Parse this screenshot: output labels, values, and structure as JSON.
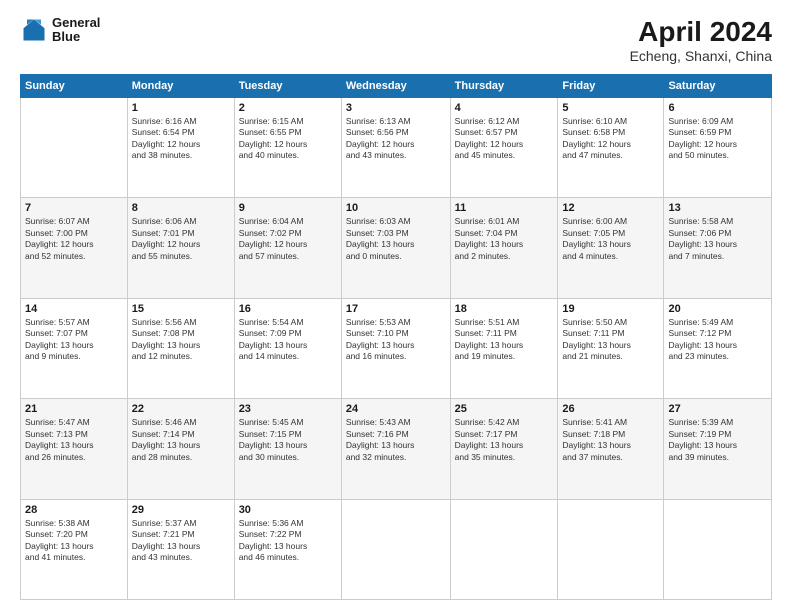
{
  "logo": {
    "line1": "General",
    "line2": "Blue"
  },
  "title": "April 2024",
  "subtitle": "Echeng, Shanxi, China",
  "weekdays": [
    "Sunday",
    "Monday",
    "Tuesday",
    "Wednesday",
    "Thursday",
    "Friday",
    "Saturday"
  ],
  "weeks": [
    [
      {
        "day": "",
        "info": ""
      },
      {
        "day": "1",
        "info": "Sunrise: 6:16 AM\nSunset: 6:54 PM\nDaylight: 12 hours\nand 38 minutes."
      },
      {
        "day": "2",
        "info": "Sunrise: 6:15 AM\nSunset: 6:55 PM\nDaylight: 12 hours\nand 40 minutes."
      },
      {
        "day": "3",
        "info": "Sunrise: 6:13 AM\nSunset: 6:56 PM\nDaylight: 12 hours\nand 43 minutes."
      },
      {
        "day": "4",
        "info": "Sunrise: 6:12 AM\nSunset: 6:57 PM\nDaylight: 12 hours\nand 45 minutes."
      },
      {
        "day": "5",
        "info": "Sunrise: 6:10 AM\nSunset: 6:58 PM\nDaylight: 12 hours\nand 47 minutes."
      },
      {
        "day": "6",
        "info": "Sunrise: 6:09 AM\nSunset: 6:59 PM\nDaylight: 12 hours\nand 50 minutes."
      }
    ],
    [
      {
        "day": "7",
        "info": "Sunrise: 6:07 AM\nSunset: 7:00 PM\nDaylight: 12 hours\nand 52 minutes."
      },
      {
        "day": "8",
        "info": "Sunrise: 6:06 AM\nSunset: 7:01 PM\nDaylight: 12 hours\nand 55 minutes."
      },
      {
        "day": "9",
        "info": "Sunrise: 6:04 AM\nSunset: 7:02 PM\nDaylight: 12 hours\nand 57 minutes."
      },
      {
        "day": "10",
        "info": "Sunrise: 6:03 AM\nSunset: 7:03 PM\nDaylight: 13 hours\nand 0 minutes."
      },
      {
        "day": "11",
        "info": "Sunrise: 6:01 AM\nSunset: 7:04 PM\nDaylight: 13 hours\nand 2 minutes."
      },
      {
        "day": "12",
        "info": "Sunrise: 6:00 AM\nSunset: 7:05 PM\nDaylight: 13 hours\nand 4 minutes."
      },
      {
        "day": "13",
        "info": "Sunrise: 5:58 AM\nSunset: 7:06 PM\nDaylight: 13 hours\nand 7 minutes."
      }
    ],
    [
      {
        "day": "14",
        "info": "Sunrise: 5:57 AM\nSunset: 7:07 PM\nDaylight: 13 hours\nand 9 minutes."
      },
      {
        "day": "15",
        "info": "Sunrise: 5:56 AM\nSunset: 7:08 PM\nDaylight: 13 hours\nand 12 minutes."
      },
      {
        "day": "16",
        "info": "Sunrise: 5:54 AM\nSunset: 7:09 PM\nDaylight: 13 hours\nand 14 minutes."
      },
      {
        "day": "17",
        "info": "Sunrise: 5:53 AM\nSunset: 7:10 PM\nDaylight: 13 hours\nand 16 minutes."
      },
      {
        "day": "18",
        "info": "Sunrise: 5:51 AM\nSunset: 7:11 PM\nDaylight: 13 hours\nand 19 minutes."
      },
      {
        "day": "19",
        "info": "Sunrise: 5:50 AM\nSunset: 7:11 PM\nDaylight: 13 hours\nand 21 minutes."
      },
      {
        "day": "20",
        "info": "Sunrise: 5:49 AM\nSunset: 7:12 PM\nDaylight: 13 hours\nand 23 minutes."
      }
    ],
    [
      {
        "day": "21",
        "info": "Sunrise: 5:47 AM\nSunset: 7:13 PM\nDaylight: 13 hours\nand 26 minutes."
      },
      {
        "day": "22",
        "info": "Sunrise: 5:46 AM\nSunset: 7:14 PM\nDaylight: 13 hours\nand 28 minutes."
      },
      {
        "day": "23",
        "info": "Sunrise: 5:45 AM\nSunset: 7:15 PM\nDaylight: 13 hours\nand 30 minutes."
      },
      {
        "day": "24",
        "info": "Sunrise: 5:43 AM\nSunset: 7:16 PM\nDaylight: 13 hours\nand 32 minutes."
      },
      {
        "day": "25",
        "info": "Sunrise: 5:42 AM\nSunset: 7:17 PM\nDaylight: 13 hours\nand 35 minutes."
      },
      {
        "day": "26",
        "info": "Sunrise: 5:41 AM\nSunset: 7:18 PM\nDaylight: 13 hours\nand 37 minutes."
      },
      {
        "day": "27",
        "info": "Sunrise: 5:39 AM\nSunset: 7:19 PM\nDaylight: 13 hours\nand 39 minutes."
      }
    ],
    [
      {
        "day": "28",
        "info": "Sunrise: 5:38 AM\nSunset: 7:20 PM\nDaylight: 13 hours\nand 41 minutes."
      },
      {
        "day": "29",
        "info": "Sunrise: 5:37 AM\nSunset: 7:21 PM\nDaylight: 13 hours\nand 43 minutes."
      },
      {
        "day": "30",
        "info": "Sunrise: 5:36 AM\nSunset: 7:22 PM\nDaylight: 13 hours\nand 46 minutes."
      },
      {
        "day": "",
        "info": ""
      },
      {
        "day": "",
        "info": ""
      },
      {
        "day": "",
        "info": ""
      },
      {
        "day": "",
        "info": ""
      }
    ]
  ]
}
